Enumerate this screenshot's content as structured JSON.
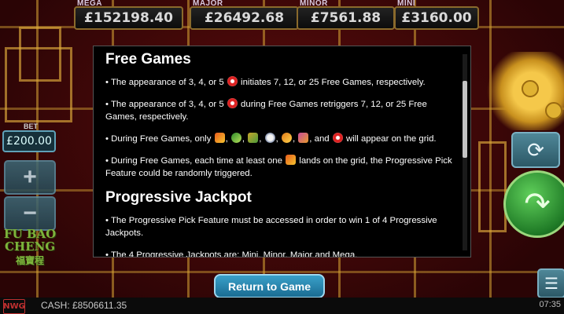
{
  "jackpots": [
    {
      "label": "MEGA",
      "value": "£152198.40"
    },
    {
      "label": "MAJOR",
      "value": "£26492.68"
    },
    {
      "label": "MINOR",
      "value": "£7561.88"
    },
    {
      "label": "MINI",
      "value": "£3160.00"
    }
  ],
  "modal": {
    "free_games": {
      "heading": "Free Games",
      "p1_a": "• The appearance of 3, 4, or 5",
      "p1_b": "initiates 7, 12, or 25 Free Games, respectively.",
      "p2_a": "• The appearance of 3, 4, or 5",
      "p2_b": "during Free Games retriggers 7, 12, or 25 Free Games, respectively.",
      "p3_a": "• During Free Games, only",
      "p3_and": ", and",
      "p3_b": "will appear on the grid.",
      "p4_a": "• During Free Games, each time at least one",
      "p4_b": "lands on the grid, the Progressive Pick Feature could be randomly triggered."
    },
    "progressive": {
      "heading": "Progressive Jackpot",
      "p1": "• The Progressive Pick Feature must be accessed in order to win 1 of 4 Progressive Jackpots.",
      "p2": "• The 4 Progressive Jackpots are: Mini, Minor, Major and Mega."
    }
  },
  "controls": {
    "bet_label": "BET",
    "bet_value": "£200.00",
    "plus": "+",
    "minus": "−",
    "logo": "FU BAO CHENG",
    "logo_cn": "福寶程",
    "refresh_icon": "⟳",
    "spin_icon": "↷",
    "menu_icon": "☰"
  },
  "return_button": "Return to Game",
  "footer": {
    "brand": "NWG",
    "cash": "CASH: £8506611.35",
    "time": "07:35"
  },
  "icons": [
    "scatter-icon",
    "dragon-box-icon",
    "frog-icon",
    "coin-stack-icon",
    "pearl-icon",
    "ingot-icon",
    "firecracker-icon"
  ],
  "colors": {
    "accent": "#2a8ab4",
    "background": "#3a0708",
    "frame_gold": "#d6a434"
  }
}
